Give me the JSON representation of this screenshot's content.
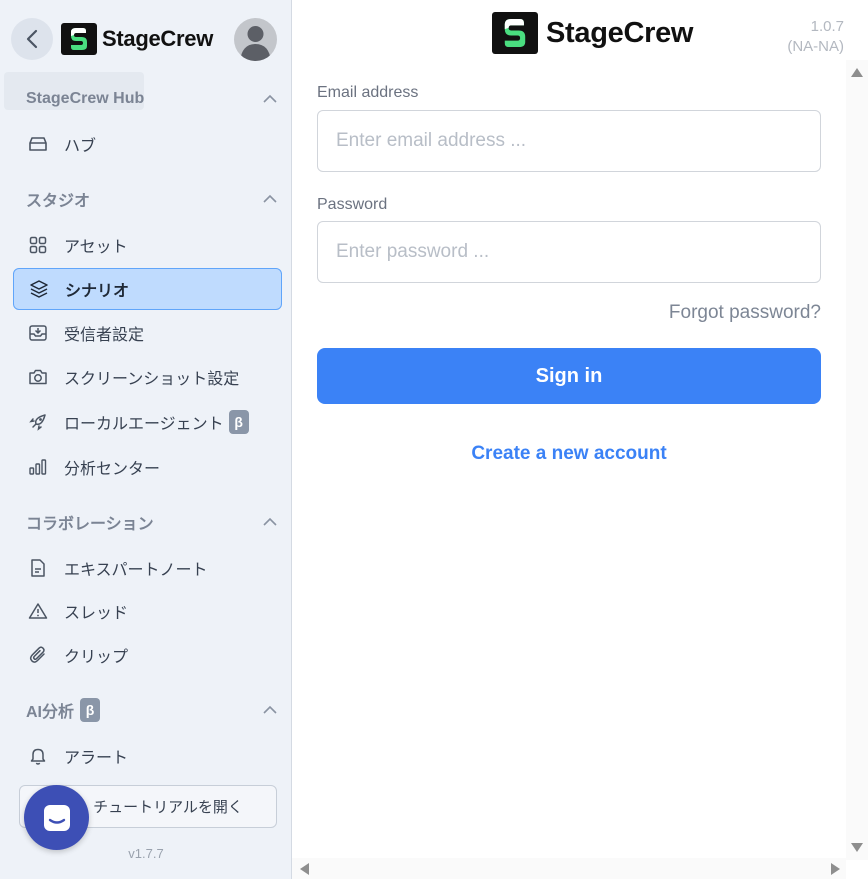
{
  "brand": {
    "name": "StageCrew"
  },
  "sidebar": {
    "sections": [
      {
        "title": "StageCrew Hub",
        "items": [
          {
            "label": "ハブ",
            "icon": "inbox-tray-icon"
          }
        ]
      },
      {
        "title": "スタジオ",
        "items": [
          {
            "label": "アセット",
            "icon": "grid-icon"
          },
          {
            "label": "シナリオ",
            "icon": "layers-icon",
            "active": true
          },
          {
            "label": "受信者設定",
            "icon": "inbox-download-icon"
          },
          {
            "label": "スクリーンショット設定",
            "icon": "camera-icon"
          },
          {
            "label": "ローカルエージェント",
            "icon": "rocket-icon",
            "badge": "β"
          },
          {
            "label": "分析センター",
            "icon": "bar-chart-icon"
          }
        ]
      },
      {
        "title": "コラボレーション",
        "items": [
          {
            "label": "エキスパートノート",
            "icon": "document-icon"
          },
          {
            "label": "スレッド",
            "icon": "warning-triangle-icon"
          },
          {
            "label": "クリップ",
            "icon": "paperclip-icon"
          }
        ]
      },
      {
        "title": "AI分析",
        "badge": "β",
        "items": [
          {
            "label": "アラート",
            "icon": "bell-icon"
          }
        ]
      }
    ],
    "tutorial_label": "チュートリアルを開く",
    "version": "v1.7.7"
  },
  "main": {
    "version": "1.0.7",
    "region": "(NA-NA)",
    "email": {
      "label": "Email address",
      "placeholder": "Enter email address ...",
      "value": ""
    },
    "password": {
      "label": "Password",
      "placeholder": "Enter password ...",
      "value": ""
    },
    "forgot_label": "Forgot password?",
    "signin_label": "Sign in",
    "create_label": "Create a new account"
  },
  "colors": {
    "accent": "#3b82f6",
    "active_bg": "#bfdbfe",
    "sidebar_bg": "#eef2f8",
    "chat_fab": "#3d4fb5"
  }
}
